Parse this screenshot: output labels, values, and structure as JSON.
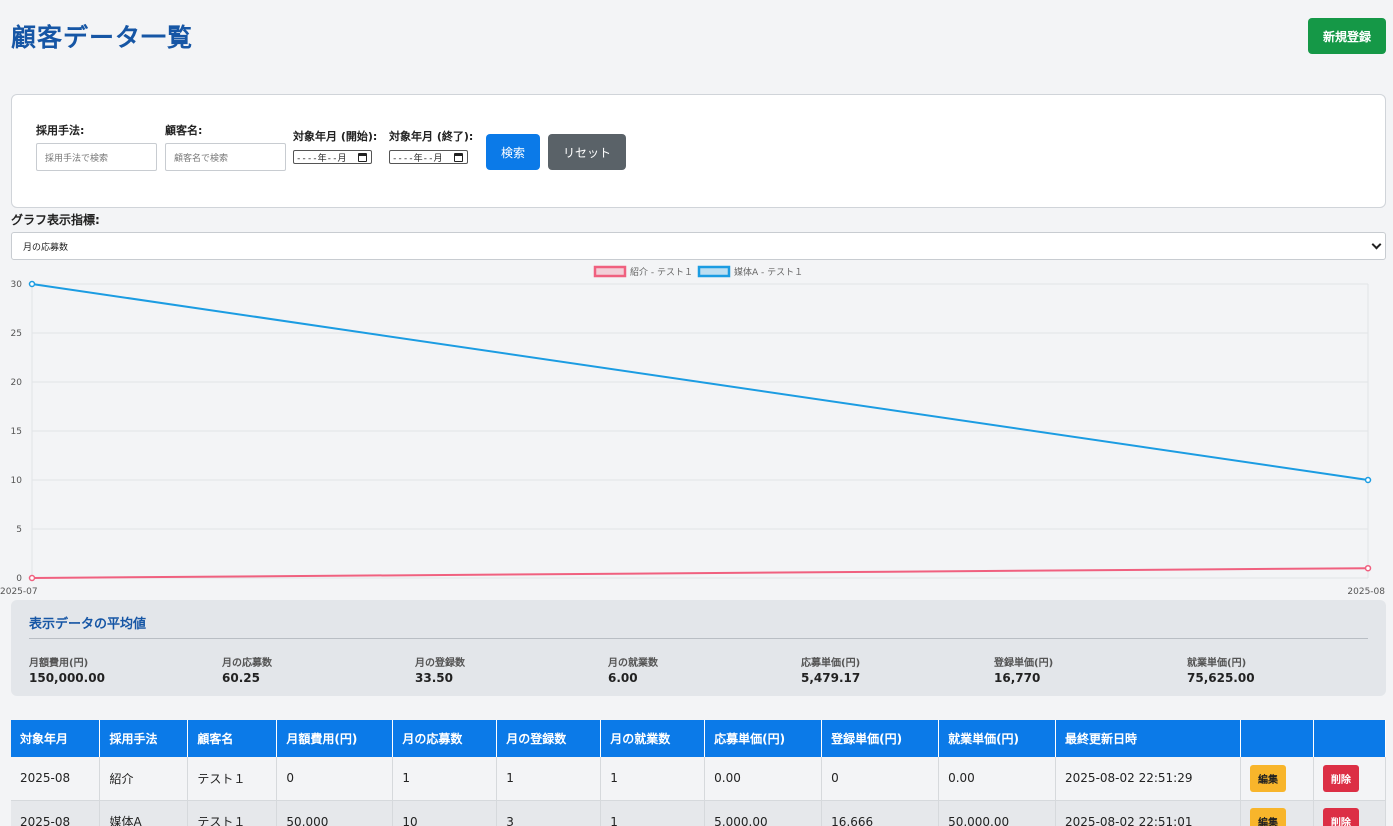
{
  "header": {
    "title": "顧客データ一覧",
    "new_button": "新規登録"
  },
  "search": {
    "method_label": "採用手法:",
    "method_placeholder": "採用手法で検索",
    "name_label": "顧客名:",
    "name_placeholder": "顧客名で検索",
    "start_label": "対象年月 (開始):",
    "end_label": "対象年月 (終了):",
    "start_value": "----年--月",
    "end_value": "----年--月",
    "search_button": "検索",
    "reset_button": "リセット"
  },
  "metric": {
    "label": "グラフ表示指標:",
    "selected": "月の応募数"
  },
  "chart_data": {
    "type": "line",
    "x": [
      "2025-07",
      "2025-08"
    ],
    "ylim": [
      0,
      30
    ],
    "yticks": [
      "0",
      "5",
      "10",
      "15",
      "20",
      "25",
      "30"
    ],
    "grid": true,
    "legend_position": "top-center",
    "series": [
      {
        "name": "紹介 - テスト１",
        "values": [
          0,
          1
        ],
        "color": "#f0607f"
      },
      {
        "name": "媒体A - テスト１",
        "values": [
          30,
          10
        ],
        "color": "#1b9ce2"
      }
    ]
  },
  "averages": {
    "title": "表示データの平均値",
    "items": [
      {
        "label": "月額費用(円)",
        "value": "150,000.00"
      },
      {
        "label": "月の応募数",
        "value": "60.25"
      },
      {
        "label": "月の登録数",
        "value": "33.50"
      },
      {
        "label": "月の就業数",
        "value": "6.00"
      },
      {
        "label": "応募単価(円)",
        "value": "5,479.17"
      },
      {
        "label": "登録単価(円)",
        "value": "16,770"
      },
      {
        "label": "就業単価(円)",
        "value": "75,625.00"
      }
    ]
  },
  "table": {
    "headers": [
      "対象年月",
      "採用手法",
      "顧客名",
      "月額費用(円)",
      "月の応募数",
      "月の登録数",
      "月の就業数",
      "応募単価(円)",
      "登録単価(円)",
      "就業単価(円)",
      "最終更新日時",
      "",
      ""
    ],
    "edit_label": "編集",
    "delete_label": "削除",
    "rows": [
      [
        "2025-08",
        "紹介",
        "テスト１",
        "0",
        "1",
        "1",
        "1",
        "0.00",
        "0",
        "0.00",
        "2025-08-02 22:51:29"
      ],
      [
        "2025-08",
        "媒体A",
        "テスト１",
        "50,000",
        "10",
        "3",
        "1",
        "5,000.00",
        "16,666",
        "50,000.00",
        "2025-08-02 22:51:01"
      ]
    ]
  }
}
